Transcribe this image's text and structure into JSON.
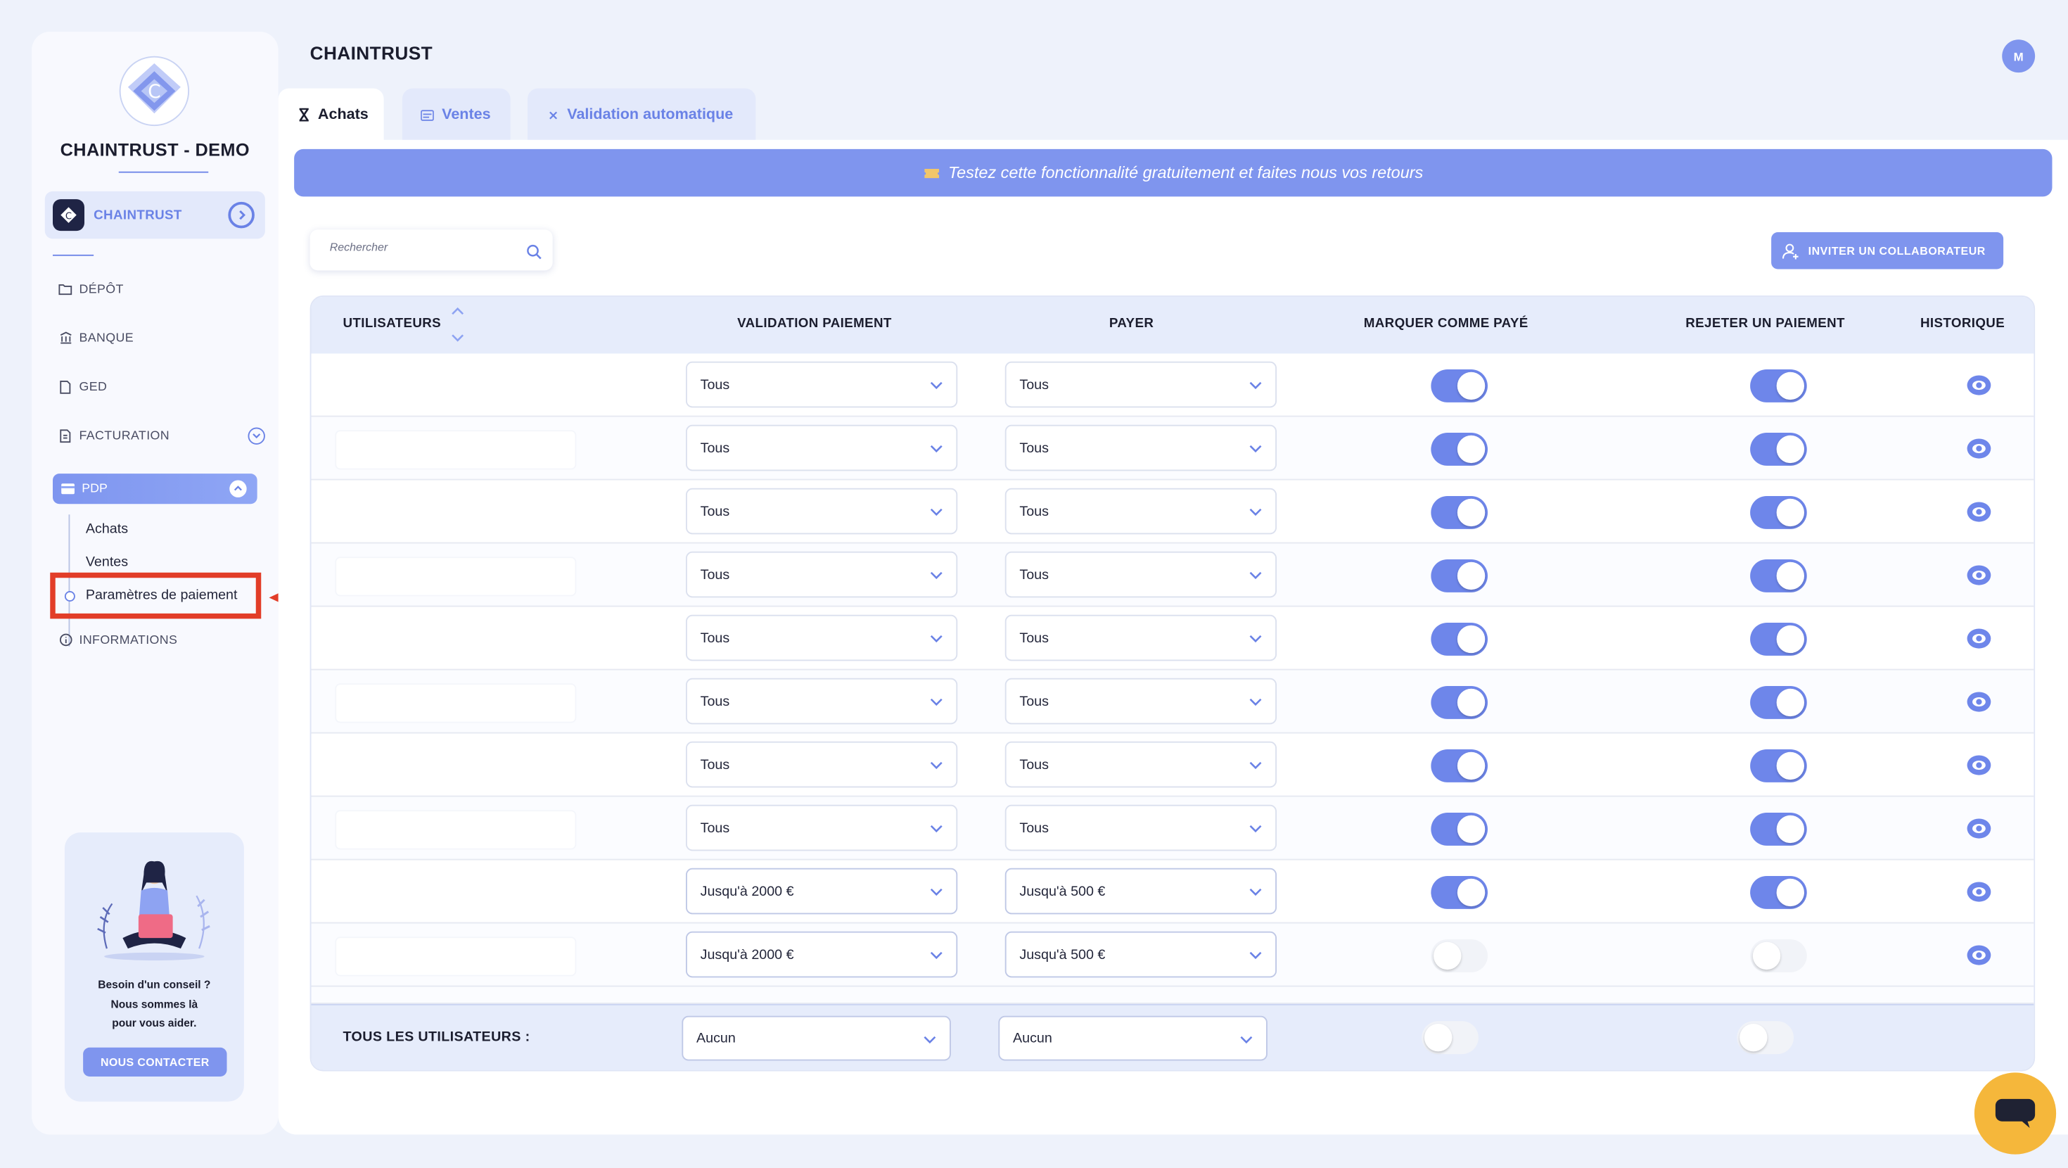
{
  "sidebar": {
    "brand_title": "CHAINTRUST - DEMO",
    "org_name": "CHAINTRUST",
    "nav": {
      "depot": "DÉPÔT",
      "banque": "BANQUE",
      "ged": "GED",
      "facturation": "FACTURATION",
      "pdp": "PDP",
      "informations": "INFORMATIONS"
    },
    "pdp_sub": {
      "achats": "Achats",
      "ventes": "Ventes",
      "parametres": "Paramètres de paiement"
    },
    "help": {
      "line1": "Besoin d'un conseil ?",
      "line2": "Nous sommes là",
      "line3": "pour vous aider.",
      "button": "NOUS CONTACTER"
    }
  },
  "header": {
    "title": "CHAINTRUST",
    "avatar_initial": "M"
  },
  "tabs": [
    {
      "label": "Achats",
      "active": true
    },
    {
      "label": "Ventes",
      "active": false
    },
    {
      "label": "Validation automatique",
      "active": false
    }
  ],
  "banner": {
    "text": "Testez cette fonctionnalité gratuitement et faites nous vos retours"
  },
  "search": {
    "placeholder": "Rechercher"
  },
  "invite_button": "INVITER UN COLLABORATEUR",
  "table": {
    "columns": {
      "users": "UTILISATEURS",
      "validation": "VALIDATION PAIEMENT",
      "payer": "PAYER",
      "marquer": "MARQUER COMME PAYÉ",
      "rejeter": "REJETER UN PAIEMENT",
      "historique": "HISTORIQUE"
    },
    "rows": [
      {
        "validation": "Tous",
        "payer": "Tous",
        "marquer": true,
        "rejeter": true
      },
      {
        "validation": "Tous",
        "payer": "Tous",
        "marquer": true,
        "rejeter": true
      },
      {
        "validation": "Tous",
        "payer": "Tous",
        "marquer": true,
        "rejeter": true
      },
      {
        "validation": "Tous",
        "payer": "Tous",
        "marquer": true,
        "rejeter": true
      },
      {
        "validation": "Tous",
        "payer": "Tous",
        "marquer": true,
        "rejeter": true
      },
      {
        "validation": "Tous",
        "payer": "Tous",
        "marquer": true,
        "rejeter": true
      },
      {
        "validation": "Tous",
        "payer": "Tous",
        "marquer": true,
        "rejeter": true
      },
      {
        "validation": "Tous",
        "payer": "Tous",
        "marquer": true,
        "rejeter": true
      },
      {
        "validation": "Jusqu'à 2000 €",
        "payer": "Jusqu'à 500 €",
        "marquer": true,
        "rejeter": true
      },
      {
        "validation": "Jusqu'à 2000 €",
        "payer": "Jusqu'à 500 €",
        "marquer": false,
        "rejeter": false
      }
    ],
    "footer": {
      "label": "TOUS LES UTILISATEURS :",
      "validation": "Aucun",
      "payer": "Aucun",
      "marquer": false,
      "rejeter": false
    }
  },
  "colors": {
    "accent": "#7f95ee",
    "toggle_on": "#6e86ea",
    "highlight": "#e23d28",
    "chat": "#f5b73b"
  },
  "icons": [
    "logo-icon",
    "folder-icon",
    "bank-icon",
    "document-icon",
    "invoice-icon",
    "card-icon",
    "info-icon",
    "search-icon",
    "user-plus-icon",
    "eye-icon",
    "chevron-down-icon",
    "hourglass-icon",
    "list-icon",
    "close-icon",
    "ticket-icon",
    "chat-icon",
    "sort-icon"
  ]
}
